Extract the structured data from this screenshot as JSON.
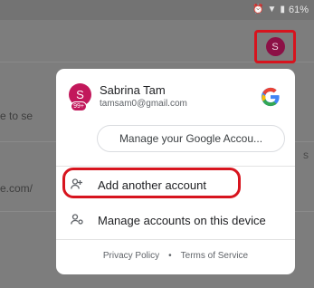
{
  "status_bar": {
    "alarm_icon": "alarm-icon",
    "wifi_icon": "wifi-icon",
    "battery_icon": "battery-icon",
    "battery_text": "61%"
  },
  "background": {
    "left_snippet_1": "e to se",
    "left_snippet_2": "e.com/",
    "right_snippet": "s",
    "avatar_letter": "S"
  },
  "account": {
    "avatar_letter": "S",
    "badge": "99+",
    "name": "Sabrina Tam",
    "email": "tamsam0@gmail.com",
    "brand_logo": "G"
  },
  "manage_button": "Manage your Google Accou...",
  "menu": {
    "add_account": "Add another account",
    "manage_accounts": "Manage accounts on this device"
  },
  "footer": {
    "privacy": "Privacy Policy",
    "separator": "•",
    "terms": "Terms of Service"
  },
  "colors": {
    "avatar": "#c2185b",
    "highlight": "#d7141e"
  }
}
